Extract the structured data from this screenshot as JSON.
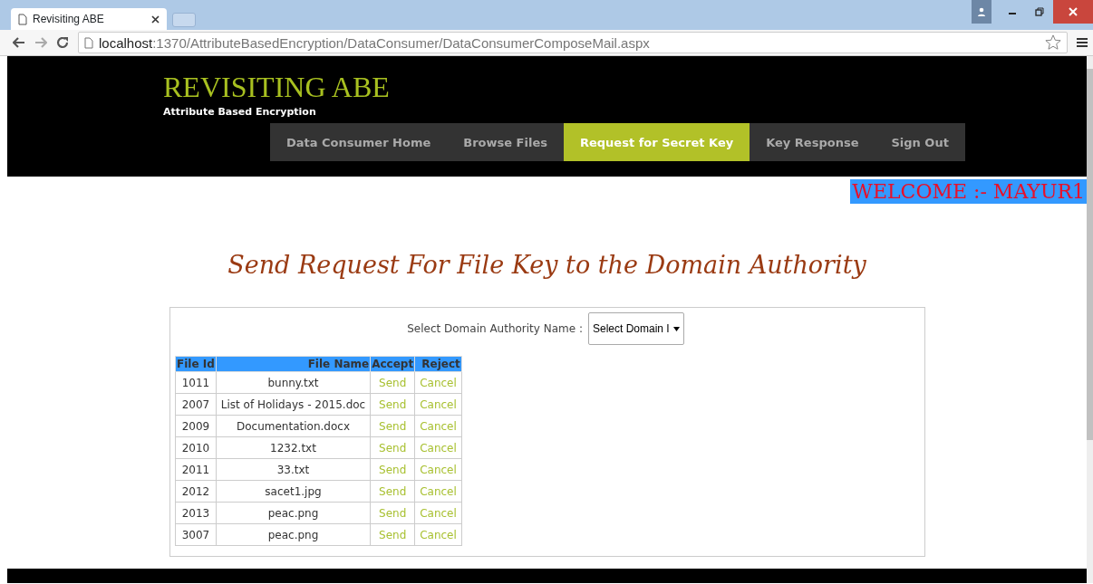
{
  "browser": {
    "tab_title": "Revisiting ABE",
    "url_host": "localhost",
    "url_path": ":1370/AttributeBasedEncryption/DataConsumer/DataConsumerComposeMail.aspx"
  },
  "header": {
    "title": "REVISITING ABE",
    "subtitle": "Attribute Based Encryption"
  },
  "nav": [
    {
      "label": "Data Consumer Home",
      "selected": false
    },
    {
      "label": "Browse Files",
      "selected": false
    },
    {
      "label": "Request for Secret Key",
      "selected": true
    },
    {
      "label": "Key Response",
      "selected": false
    },
    {
      "label": "Sign Out",
      "selected": false
    }
  ],
  "welcome": "WELCOME :- MAYUR1",
  "heading": "Send Request For File Key to the Domain Authority",
  "form": {
    "label": "Select Domain Authority Name :",
    "select_value": "Select Domain I"
  },
  "table": {
    "columns": [
      "File Id",
      "File Name",
      "Accept",
      "Reject"
    ],
    "rows": [
      {
        "file_id": "1011",
        "file_name": "bunny.txt",
        "accept": "Send",
        "reject": "Cancel"
      },
      {
        "file_id": "2007",
        "file_name": "List of Holidays - 2015.doc",
        "accept": "Send",
        "reject": "Cancel"
      },
      {
        "file_id": "2009",
        "file_name": "Documentation.docx",
        "accept": "Send",
        "reject": "Cancel"
      },
      {
        "file_id": "2010",
        "file_name": "1232.txt",
        "accept": "Send",
        "reject": "Cancel"
      },
      {
        "file_id": "2011",
        "file_name": "33.txt",
        "accept": "Send",
        "reject": "Cancel"
      },
      {
        "file_id": "2012",
        "file_name": "sacet1.jpg",
        "accept": "Send",
        "reject": "Cancel"
      },
      {
        "file_id": "2013",
        "file_name": "peac.png",
        "accept": "Send",
        "reject": "Cancel"
      },
      {
        "file_id": "3007",
        "file_name": "peac.png",
        "accept": "Send",
        "reject": "Cancel"
      }
    ]
  }
}
